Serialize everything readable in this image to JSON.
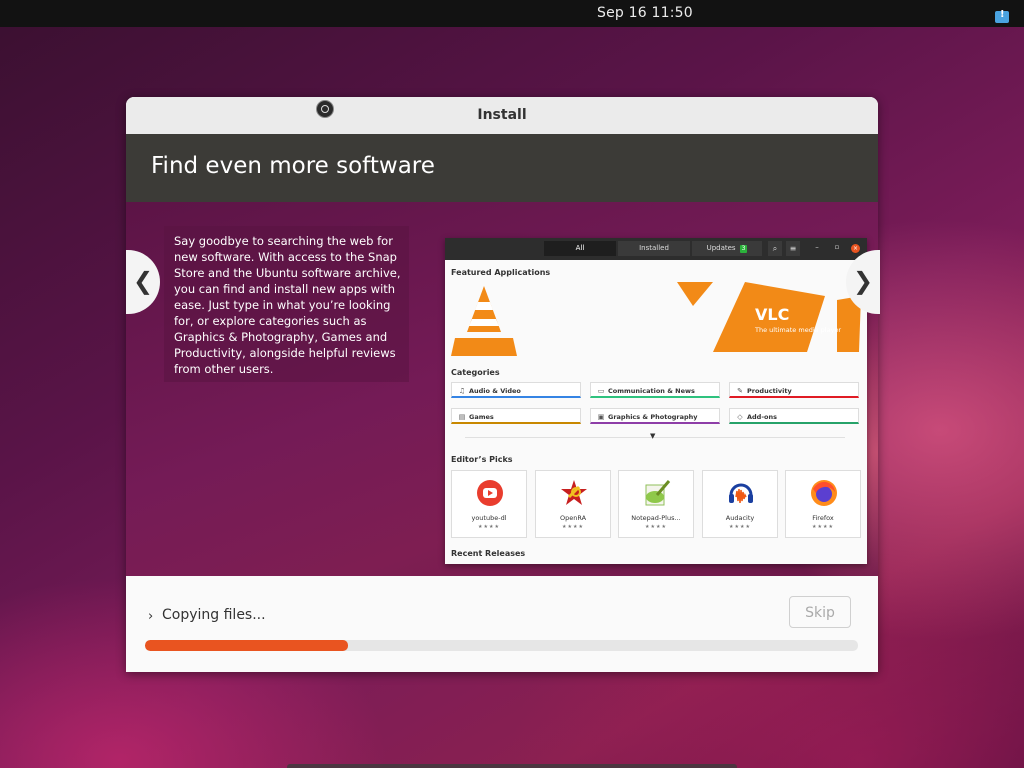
{
  "topbar": {
    "clock": "Sep 16  11:50",
    "notify_icon": "notification-icon"
  },
  "window": {
    "title": "Install"
  },
  "slide": {
    "title": "Find even more software",
    "description": "Say goodbye to searching the web for new software. With access to the Snap Store and the Ubuntu software archive, you can find and install new apps with ease. Just type in what you’re looking for, or explore categories such as Graphics & Photography, Games and Productivity, alongside helpful reviews from other users.",
    "prev_label": "❮",
    "next_label": "❯"
  },
  "store": {
    "tabs": {
      "all": "All",
      "installed": "Installed",
      "updates": "Updates",
      "updates_count": "3"
    },
    "featured_label": "Featured Applications",
    "banner": {
      "name": "VLC",
      "tagline": "The ultimate media player"
    },
    "categories_label": "Categories",
    "categories": {
      "audio_video": "Audio & Video",
      "communication": "Communication & News",
      "productivity": "Productivity",
      "games": "Games",
      "graphics": "Graphics & Photography",
      "addons": "Add-ons"
    },
    "picks_label": "Editor’s Picks",
    "picks": [
      {
        "name": "youtube-dl",
        "rating": "★★★★"
      },
      {
        "name": "OpenRA",
        "rating": "★★★★"
      },
      {
        "name": "Notepad-Plus...",
        "rating": "★★★★"
      },
      {
        "name": "Audacity",
        "rating": "★★★★"
      },
      {
        "name": "Firefox",
        "rating": "★★★★"
      }
    ],
    "recent_label": "Recent Releases"
  },
  "progress": {
    "status": "Copying files...",
    "skip_label": "Skip",
    "fraction": 0.285
  },
  "colors": {
    "accent": "#e95420",
    "header": "#3c3b37"
  }
}
